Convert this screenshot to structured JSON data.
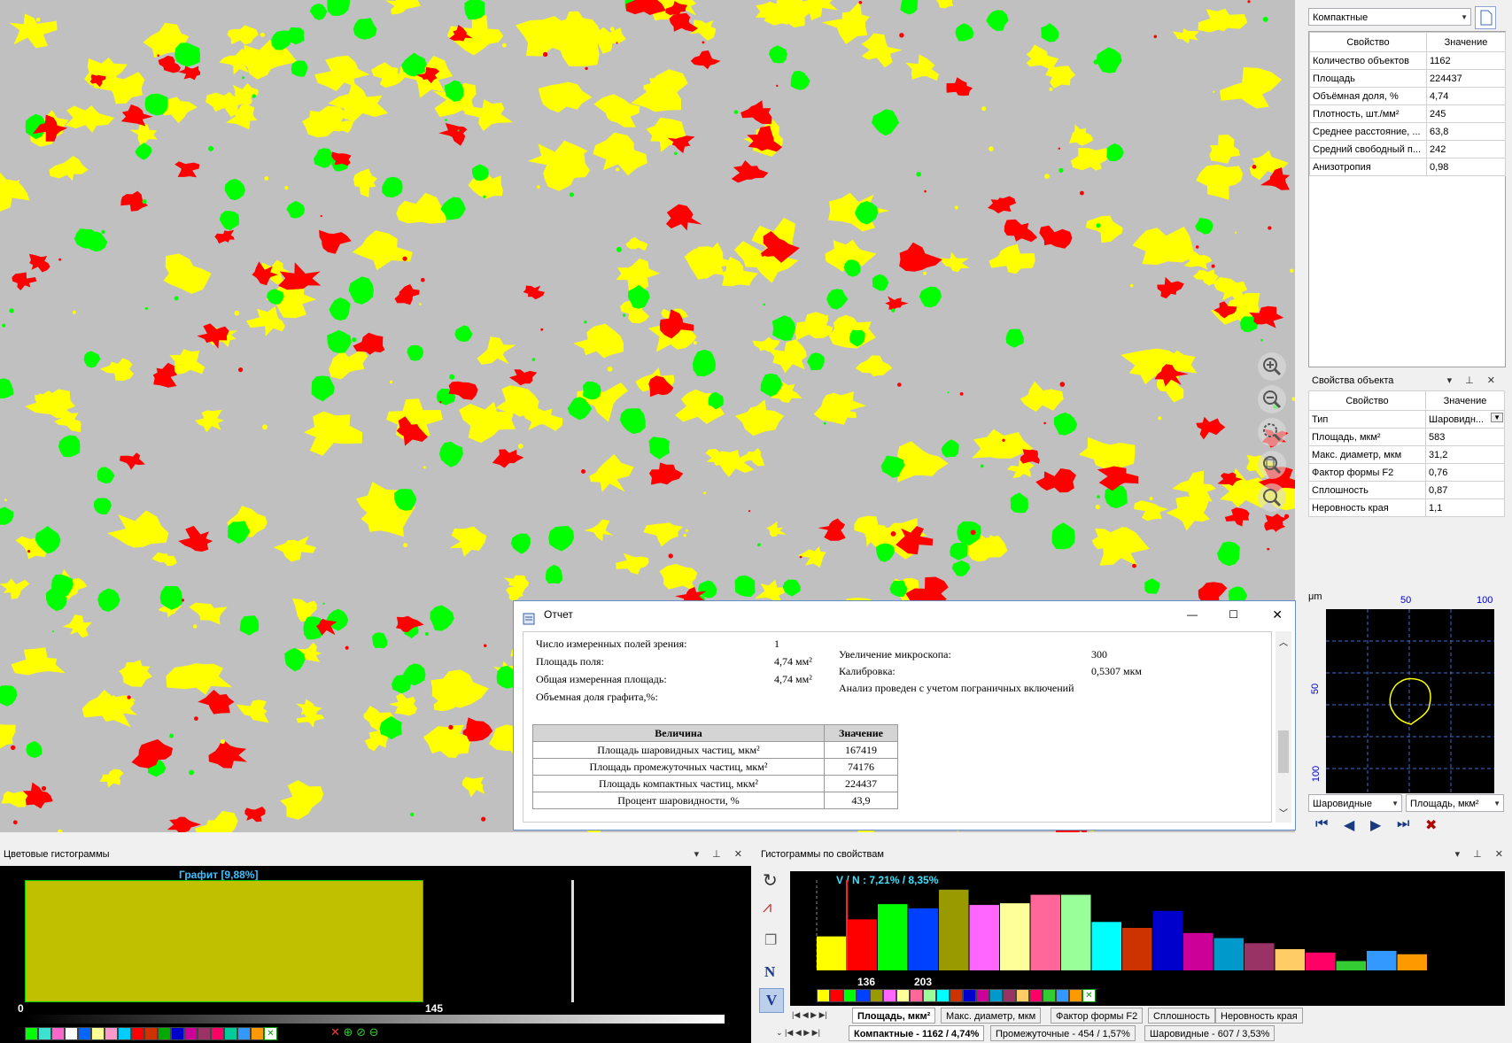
{
  "viewer": {
    "colors": {
      "background": "#c0c0c0",
      "spherical": "#00ff00",
      "compact": "#ff0000",
      "intermediate": "#ffff00"
    },
    "zoom_tools": [
      "zoom-in-icon",
      "zoom-out-icon",
      "zoom-selection-icon",
      "zoom-fit-icon",
      "magnifier-icon"
    ]
  },
  "right_panel": {
    "class_select": "Компактные",
    "summary_table": {
      "headers": [
        "Свойство",
        "Значение"
      ],
      "rows": [
        [
          "Количество объектов",
          "1162"
        ],
        [
          "Площадь",
          "224437"
        ],
        [
          "Объёмная доля, %",
          "4,74"
        ],
        [
          "Плотность, шт./мм²",
          "245"
        ],
        [
          "Среднее расстояние, ...",
          "63,8"
        ],
        [
          "Средний свободный п...",
          "242"
        ],
        [
          "Анизотропия",
          "0,98"
        ]
      ]
    },
    "object_panel": {
      "title": "Свойства объекта",
      "headers": [
        "Свойство",
        "Значение"
      ],
      "rows": [
        [
          "Тип",
          "Шаровидн..."
        ],
        [
          "Площадь, мкм²",
          "583"
        ],
        [
          "Макс. диаметр, мкм",
          "31,2"
        ],
        [
          "Фактор формы F2",
          "0,76"
        ],
        [
          "Сплошность",
          "0,87"
        ],
        [
          "Неровность края",
          "1,1"
        ]
      ]
    },
    "preview": {
      "unit": "μm",
      "top_ticks": [
        "50",
        "100"
      ],
      "left_ticks": [
        "50",
        "100"
      ]
    },
    "preview_selects": [
      "Шаровидные",
      "Площадь, мкм²"
    ]
  },
  "report": {
    "title": "Отчет",
    "left_lines": [
      {
        "label": "Число измеренных полей зрения:",
        "value": "1"
      },
      {
        "label": "Площадь поля:",
        "value": "4,74 мм²"
      },
      {
        "label": "Общая измеренная площадь:",
        "value": "4,74 мм²"
      },
      {
        "label": "Объемная доля графита,%:",
        "value": ""
      }
    ],
    "right_lines": [
      {
        "label": "Увеличение микроскопа:",
        "value": "300"
      },
      {
        "label": "Калибровка:",
        "value": "0,5307 мкм"
      },
      {
        "label": "Анализ проведен с учетом пограничных включений",
        "value": ""
      }
    ],
    "table": {
      "headers": [
        "Величина",
        "Значение"
      ],
      "rows": [
        [
          "Площадь шаровидных частиц, мкм²",
          "167419"
        ],
        [
          "Площадь промежуточных частиц, мкм²",
          "74176"
        ],
        [
          "Площадь компактных частиц, мкм²",
          "224437"
        ],
        [
          "Процент шаровидности, %",
          "43,9"
        ]
      ]
    }
  },
  "color_hist": {
    "title": "Цветовые гистограммы",
    "label": "Графит [9,88%]",
    "range_start": "0",
    "range_end": "145",
    "bar_color": "#c0c000",
    "palette": [
      "#00ff00",
      "#40e0d0",
      "#ff66cc",
      "#ffffff",
      "#0066ff",
      "#ffff99",
      "#ff99cc",
      "#00ccff",
      "#ff0000",
      "#cc3300",
      "#00aa00",
      "#0000cc",
      "#cc0099",
      "#993366",
      "#ff0066",
      "#00cc99",
      "#3399ff",
      "#ff9900"
    ]
  },
  "prop_hist": {
    "title": "Гистограммы по свойствам",
    "label": "V / N : 7,21% / 8,35%",
    "marker_a": "136",
    "marker_b": "203",
    "buttons": [
      "N",
      "V"
    ],
    "property_tabs": [
      "Площадь, мкм²",
      "Макс. диаметр, мкм",
      "Фактор формы F2",
      "Сплошность",
      "Неровность края"
    ],
    "class_tabs": [
      "Компактные - 1162 / 4,74%",
      "Промежуточные - 454 / 1,57%",
      "Шаровидные - 607 / 3,53%"
    ]
  },
  "chart_data": {
    "type": "bar",
    "series": [
      {
        "values": [
          40,
          60,
          78,
          73,
          95,
          77,
          79,
          89,
          89,
          57,
          50,
          70,
          44,
          38,
          32,
          25,
          21,
          11,
          23,
          19
        ]
      }
    ],
    "colors": [
      "#ffff00",
      "#ff0000",
      "#00ff00",
      "#0040ff",
      "#999900",
      "#ff66ff",
      "#ffff99",
      "#ff6699",
      "#99ff99",
      "#00ffff",
      "#cc3300",
      "#0000cc",
      "#cc0099",
      "#0099cc",
      "#993366",
      "#ffcc66",
      "#ff0066",
      "#33cc33",
      "#3399ff",
      "#ff9900"
    ]
  }
}
